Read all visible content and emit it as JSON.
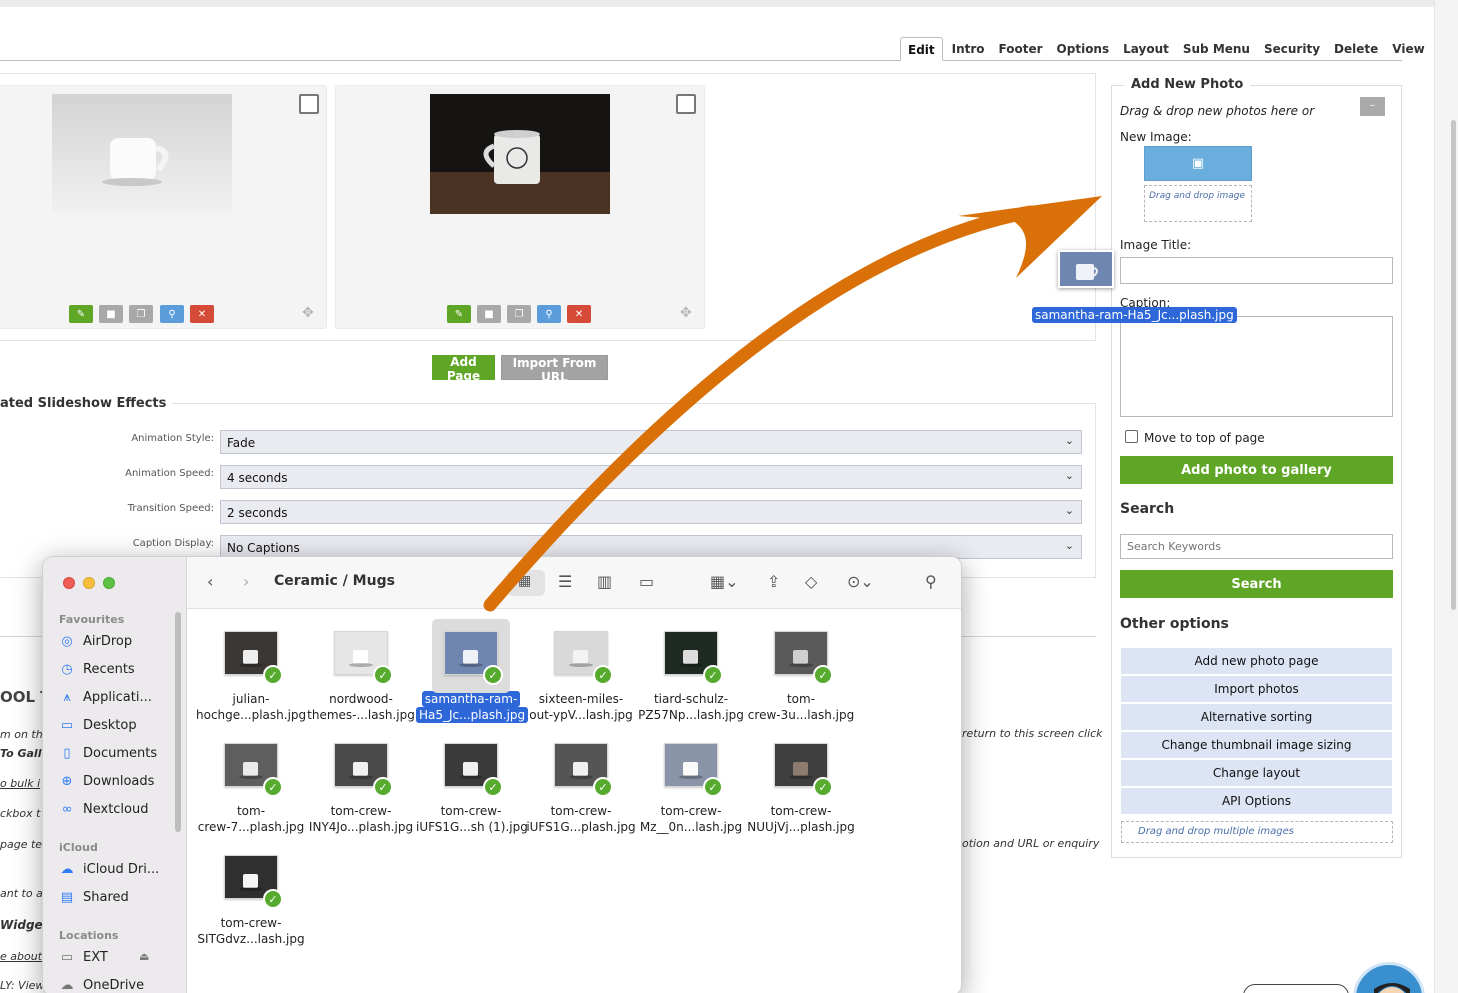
{
  "tabs": [
    "Edit",
    "Intro",
    "Footer",
    "Options",
    "Layout",
    "Sub Menu",
    "Security",
    "Delete",
    "View"
  ],
  "page_buttons": {
    "add_page": "Add Page",
    "import_url": "Import From URL"
  },
  "effects": {
    "heading": "ated Slideshow Effects",
    "fields": [
      {
        "label": "Animation Style:",
        "value": "Fade"
      },
      {
        "label": "Animation Speed:",
        "value": "4 seconds"
      },
      {
        "label": "Transition Speed:",
        "value": "2 seconds"
      },
      {
        "label": "Caption Display:",
        "value": "No Captions"
      }
    ]
  },
  "right_panel": {
    "title": "Add New Photo",
    "drag_text": "Drag & drop new photos here or",
    "collapse": "–",
    "new_image": "New Image:",
    "drop_image": "Drag and drop image",
    "image_title": "Image Title:",
    "caption": "Caption:",
    "move_top": "Move to top of page",
    "add_btn": "Add photo to gallery",
    "search_heading": "Search",
    "search_placeholder": "Search Keywords",
    "search_btn": "Search",
    "other_heading": "Other options",
    "options": [
      "Add new photo page",
      "Import photos",
      "Alternative sorting",
      "Change thumbnail image sizing",
      "Change layout",
      "API Options"
    ],
    "drop_multi": "Drag and drop multiple images"
  },
  "bg_text": {
    "left1": "OOL T",
    "left2": "m on th",
    "left3": "To Gall",
    "left4": "o bulk i",
    "left5": "ckbox t",
    "left6": "page te",
    "left7": "ant to a",
    "left8": "Widgets",
    "left9": "e about",
    "left10": "LY: View",
    "right1": "return to this screen click",
    "right2": "otion and URL or enquiry"
  },
  "drag_label": "samantha-ram-Ha5_Jc...plash.jpg",
  "finder": {
    "path": "Ceramic / Mugs",
    "favourites_heading": "Favourites",
    "favourites": [
      {
        "label": "AirDrop",
        "icon": "airdrop-icon"
      },
      {
        "label": "Recents",
        "icon": "clock-icon"
      },
      {
        "label": "Applicati...",
        "icon": "applications-icon"
      },
      {
        "label": "Desktop",
        "icon": "desktop-icon"
      },
      {
        "label": "Documents",
        "icon": "document-icon"
      },
      {
        "label": "Downloads",
        "icon": "download-icon"
      },
      {
        "label": "Nextcloud",
        "icon": "nextcloud-icon"
      }
    ],
    "icloud_heading": "iCloud",
    "icloud": [
      {
        "label": "iCloud Dri...",
        "icon": "cloud-icon"
      },
      {
        "label": "Shared",
        "icon": "shared-folder-icon"
      }
    ],
    "locations_heading": "Locations",
    "locations": [
      {
        "label": "EXT",
        "icon": "drive-icon"
      },
      {
        "label": "OneDrive",
        "icon": "cloud-icon"
      }
    ],
    "files": [
      {
        "l1": "julian-",
        "l2": "hochge...plash.jpg",
        "selected": false
      },
      {
        "l1": "nordwood-",
        "l2": "themes-...lash.jpg",
        "selected": false
      },
      {
        "l1": "samantha-ram-",
        "l2": "Ha5_Jc...plash.jpg",
        "selected": true
      },
      {
        "l1": "sixteen-miles-",
        "l2": "out-ypV...lash.jpg",
        "selected": false
      },
      {
        "l1": "tiard-schulz-",
        "l2": "PZ57Np...lash.jpg",
        "selected": false
      },
      {
        "l1": "tom-",
        "l2": "crew-3u...lash.jpg",
        "selected": false
      },
      {
        "l1": "tom-",
        "l2": "crew-7...plash.jpg",
        "selected": false
      },
      {
        "l1": "tom-crew-",
        "l2": "INY4Jo...plash.jpg",
        "selected": false
      },
      {
        "l1": "tom-crew-",
        "l2": "iUFS1G...sh (1).jpg",
        "selected": false
      },
      {
        "l1": "tom-crew-",
        "l2": "iUFS1G...plash.jpg",
        "selected": false
      },
      {
        "l1": "tom-crew-",
        "l2": "Mz__0n...lash.jpg",
        "selected": false
      },
      {
        "l1": "tom-crew-",
        "l2": "NUUjVj...plash.jpg",
        "selected": false
      },
      {
        "l1": "tom-crew-",
        "l2": "SITGdvz...lash.jpg",
        "selected": false
      }
    ]
  },
  "colors": {
    "accent_green": "#5fa526",
    "drag_arrow": "#d97008",
    "finder_select": "#2e67d8",
    "option_bg": "#dde4f3"
  }
}
